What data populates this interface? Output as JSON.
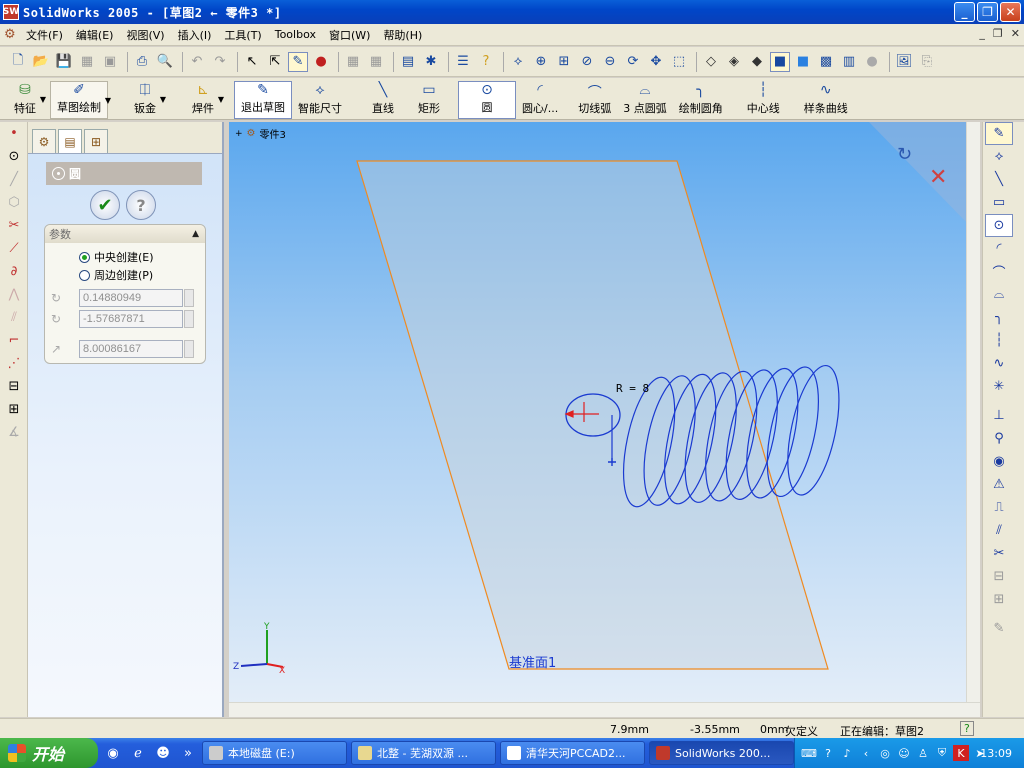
{
  "window": {
    "title": "SolidWorks 2005 - [草图2 ← 零件3 *]",
    "app_icon_text": "SW"
  },
  "menu": {
    "items": [
      "文件(F)",
      "编辑(E)",
      "视图(V)",
      "插入(I)",
      "工具(T)",
      "Toolbox",
      "窗口(W)",
      "帮助(H)"
    ]
  },
  "command_manager": {
    "items": [
      "特征",
      "草图绘制",
      "钣金",
      "焊件",
      "退出草图",
      "智能尺寸",
      "直线",
      "矩形",
      "圆",
      "圆心/...",
      "切线弧",
      "3 点圆弧",
      "绘制圆角",
      "中心线",
      "样条曲线"
    ],
    "active_item": "圆"
  },
  "property_manager": {
    "title": "圆",
    "group_title": "参数",
    "radio_options": [
      "中央创建(E)",
      "周边创建(P)"
    ],
    "radio_selected": "中央创建(E)",
    "center_x": "0.14880949",
    "center_y": "-1.57687871",
    "radius": "8.00086167"
  },
  "graphics": {
    "tree_root": "零件3",
    "dimension_label": "R = 8",
    "plane_label": "基准面1",
    "triad_x": "X",
    "triad_y": "Y",
    "triad_z": "Z",
    "helix_coils": 9
  },
  "status": {
    "x": "7.9mm",
    "y": "-3.55mm",
    "z": "0mm",
    "definition": "欠定义",
    "editing": "正在编辑：草图2",
    "help": "?"
  },
  "taskbar": {
    "start": "开始",
    "tasks": [
      "本地磁盘 (E:)",
      "北整 - 芜湖双源 ...",
      "清华天河PCCAD2...",
      "SolidWorks 200..."
    ],
    "clock": "13:09"
  },
  "colors": {
    "sketch_blue": "#1a3ad0",
    "plane_orange": "#f08a20",
    "title_blue": "#0a5fd8",
    "taskbar_blue": "#245edc"
  }
}
